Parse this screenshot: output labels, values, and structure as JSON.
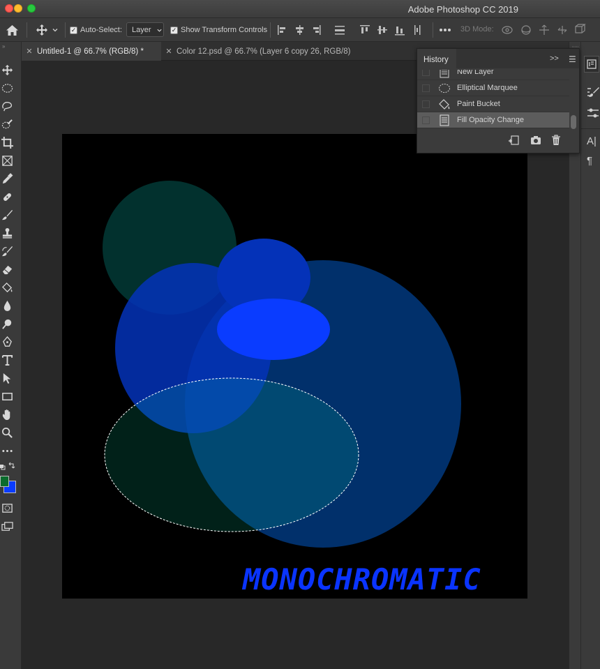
{
  "app": {
    "title": "Adobe Photoshop CC 2019"
  },
  "options_bar": {
    "auto_select_label": "Auto-Select:",
    "auto_select_checked": true,
    "layer_select_value": "Layer",
    "show_transform_label": "Show Transform Controls",
    "show_transform_checked": true,
    "mode_3d_label": "3D Mode:"
  },
  "tabs": [
    {
      "label": "Untitled-1 @ 66.7% (RGB/8) *",
      "active": true
    },
    {
      "label": "Color 12.psd @ 66.7% (Layer 6 copy 26, RGB/8)",
      "active": false
    }
  ],
  "canvas": {
    "text": "MONOCHROMATIC",
    "colors": {
      "background": "#000000",
      "teal": "#02312e",
      "blue": "#0432b8",
      "navy": "#01306b",
      "bright_blue": "#0a3cff",
      "text": "#0a34ff"
    }
  },
  "history": {
    "tab_label": "History",
    "items": [
      {
        "label": "New Layer",
        "icon": "layer-doc-icon"
      },
      {
        "label": "Elliptical Marquee",
        "icon": "elliptical-marquee-icon"
      },
      {
        "label": "Paint Bucket",
        "icon": "paint-bucket-icon"
      },
      {
        "label": "Fill Opacity Change",
        "icon": "layer-doc-icon",
        "selected": true
      }
    ]
  },
  "colors": {
    "foreground": "#0a6b2c",
    "background": "#0a3cff"
  },
  "dock": {
    "character_glyph": "A|",
    "paragraph_glyph": "¶"
  }
}
